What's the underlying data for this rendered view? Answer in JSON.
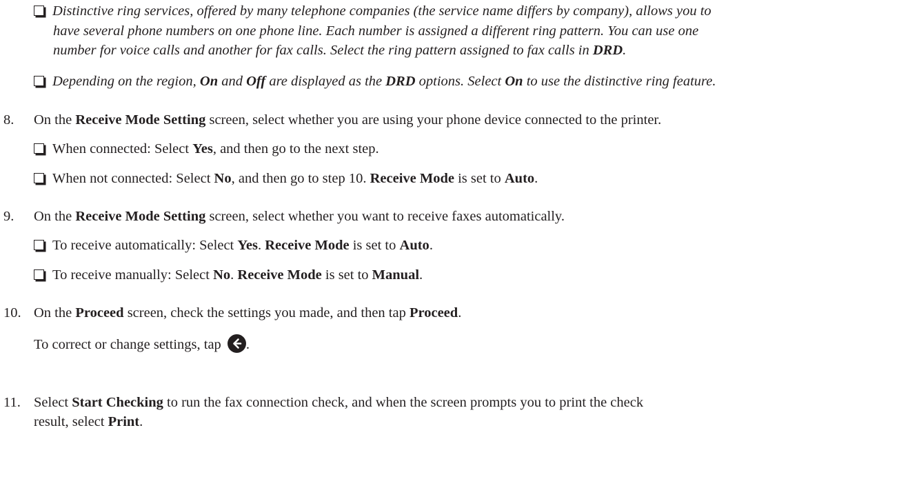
{
  "notes": {
    "distinctive_ring": {
      "line1": "Distinctive ring services, offered by many telephone companies (the service name differs by company), allows you to",
      "line2": "have several phone numbers on one phone line. Each number is assigned a different ring pattern. You can use one",
      "line3_a": "number for voice calls and another for fax calls. Select the ring pattern assigned to fax calls in ",
      "line3_b": "DRD",
      "line3_c": "."
    },
    "region": {
      "a": "Depending on the region, ",
      "on": "On",
      "b": " and ",
      "off": "Off",
      "c": " are displayed as the ",
      "drd": "DRD",
      "d": " options. Select ",
      "on2": "On",
      "e": " to use the distinctive ring feature."
    }
  },
  "steps": {
    "s8": {
      "num": "8.",
      "a": "On the ",
      "screen": "Receive Mode Setting",
      "b": " screen, select whether you are using your phone device connected to the printer.",
      "opt1_a": "When connected: Select ",
      "opt1_yes": "Yes",
      "opt1_b": ", and then go to the next step.",
      "opt2_a": "When not connected: Select ",
      "opt2_no": "No",
      "opt2_b": ", and then go to step 10. ",
      "opt2_mode": "Receive Mode",
      "opt2_c": " is set to ",
      "opt2_auto": "Auto",
      "opt2_d": "."
    },
    "s9": {
      "num": "9.",
      "a": "On the ",
      "screen": "Receive Mode Setting",
      "b": " screen, select whether you want to receive faxes automatically.",
      "opt1_a": "To receive automatically: Select ",
      "opt1_yes": "Yes",
      "opt1_b": ". ",
      "opt1_mode": "Receive Mode",
      "opt1_c": " is set to ",
      "opt1_auto": "Auto",
      "opt1_d": ".",
      "opt2_a": "To receive manually: Select ",
      "opt2_no": "No",
      "opt2_b": ". ",
      "opt2_mode": "Receive Mode",
      "opt2_c": " is set to ",
      "opt2_manual": "Manual",
      "opt2_d": "."
    },
    "s10": {
      "num": "10.",
      "a": "On the ",
      "screen": "Proceed",
      "b": " screen, check the settings you made, and then tap ",
      "button": "Proceed",
      "c": ".",
      "sub": "To correct or change settings, tap ",
      "sub_end": ".",
      "icon": "back-arrow-icon"
    },
    "s11": {
      "num": "11.",
      "a": "Select ",
      "start": "Start Checking",
      "b": " to run the fax connection check, and when the screen prompts you to print the check",
      "c": "result, select ",
      "print": "Print",
      "d": "."
    }
  }
}
